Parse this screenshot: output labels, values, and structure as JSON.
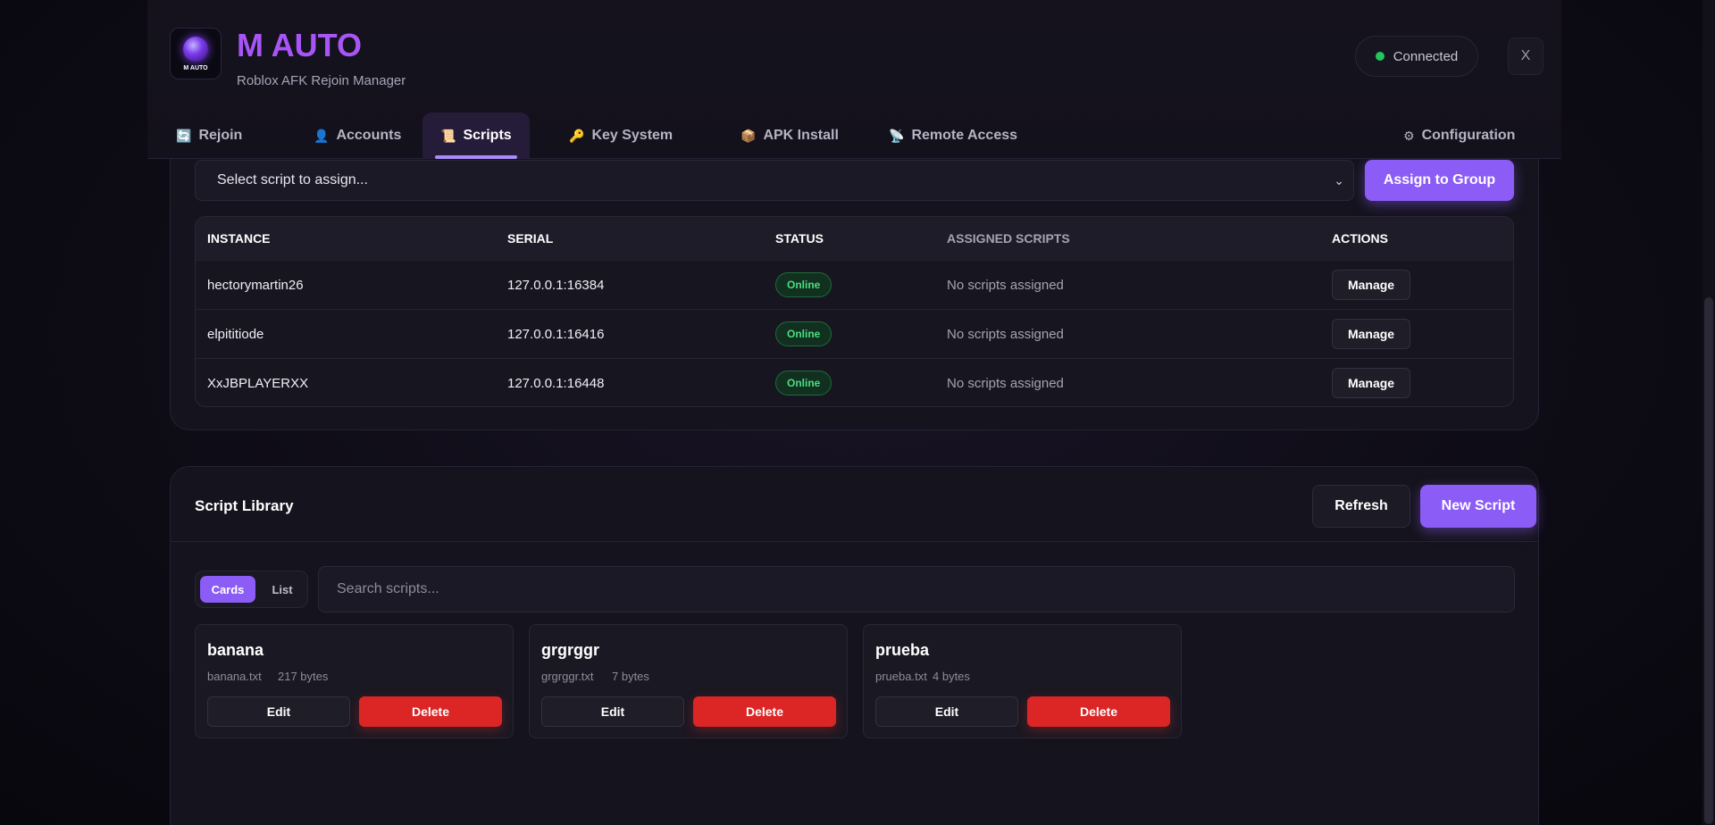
{
  "header": {
    "logo_text": "M AUTO",
    "title": "M AUTO",
    "subtitle": "Roblox AFK Rejoin Manager",
    "connection_status": "Connected",
    "close_label": "X"
  },
  "tabs": [
    {
      "label": "Rejoin",
      "icon": "🔄"
    },
    {
      "label": "Accounts",
      "icon": "👤"
    },
    {
      "label": "Scripts",
      "icon": "📜"
    },
    {
      "label": "Key System",
      "icon": "🔑"
    },
    {
      "label": "APK Install",
      "icon": "📦"
    },
    {
      "label": "Remote Access",
      "icon": "📡"
    },
    {
      "label": "Configuration",
      "icon": "⚙"
    }
  ],
  "assign": {
    "select_value": "Select script to assign...",
    "button_label": "Assign to Group"
  },
  "instances_table": {
    "headers": [
      "INSTANCE",
      "SERIAL",
      "STATUS",
      "ASSIGNED SCRIPTS",
      "ACTIONS"
    ],
    "rows": [
      {
        "instance": "hectorymartin26",
        "serial": "127.0.0.1:16384",
        "status": "Online",
        "scripts": "No scripts assigned",
        "action": "Manage"
      },
      {
        "instance": "elpititiode",
        "serial": "127.0.0.1:16416",
        "status": "Online",
        "scripts": "No scripts assigned",
        "action": "Manage"
      },
      {
        "instance": "XxJBPLAYERXX",
        "serial": "127.0.0.1:16448",
        "status": "Online",
        "scripts": "No scripts assigned",
        "action": "Manage"
      }
    ]
  },
  "library": {
    "title": "Script Library",
    "refresh_label": "Refresh",
    "new_label": "New Script",
    "view_cards": "Cards",
    "view_list": "List",
    "search_placeholder": "Search scripts...",
    "scripts": [
      {
        "name": "banana",
        "file": "banana.txt",
        "size": "217 bytes",
        "edit": "Edit",
        "delete": "Delete"
      },
      {
        "name": "grgrggr",
        "file": "grgrggr.txt",
        "size": "7 bytes",
        "edit": "Edit",
        "delete": "Delete"
      },
      {
        "name": "prueba",
        "file": "prueba.txt",
        "size": "4 bytes",
        "edit": "Edit",
        "delete": "Delete"
      }
    ]
  },
  "colors": {
    "accent": "#8b5cf6",
    "title": "#a855f7",
    "online": "#4ade80",
    "danger": "#dc2626"
  }
}
